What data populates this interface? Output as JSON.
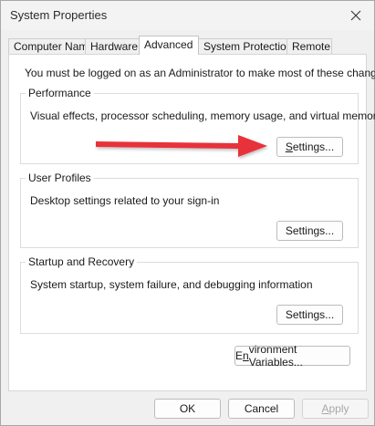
{
  "window": {
    "title": "System Properties"
  },
  "tabs": [
    {
      "label": "Computer Name"
    },
    {
      "label": "Hardware"
    },
    {
      "label": "Advanced"
    },
    {
      "label": "System Protection"
    },
    {
      "label": "Remote"
    }
  ],
  "active_tab": "Advanced",
  "notice": "You must be logged on as an Administrator to make most of these changes.",
  "groups": {
    "performance": {
      "title": "Performance",
      "desc": "Visual effects, processor scheduling, memory usage, and virtual memory",
      "button": {
        "underlined": "S",
        "rest": "ettings..."
      }
    },
    "profiles": {
      "title": "User Profiles",
      "desc": "Desktop settings related to your sign-in",
      "button": {
        "underlined": "",
        "rest": "Settings..."
      }
    },
    "startup": {
      "title": "Startup and Recovery",
      "desc": "System startup, system failure, and debugging information",
      "button": {
        "underlined": "",
        "rest": "Settings..."
      }
    }
  },
  "env_button": {
    "before": "E",
    "underlined": "n",
    "after": "vironment Variables..."
  },
  "footer": {
    "ok": "OK",
    "cancel": "Cancel",
    "apply": {
      "underlined": "A",
      "rest": "pply"
    }
  },
  "annotation_arrow": {
    "color": "#e8333a",
    "icon": "red-arrow-icon"
  },
  "icons": {
    "close": "close-icon"
  }
}
